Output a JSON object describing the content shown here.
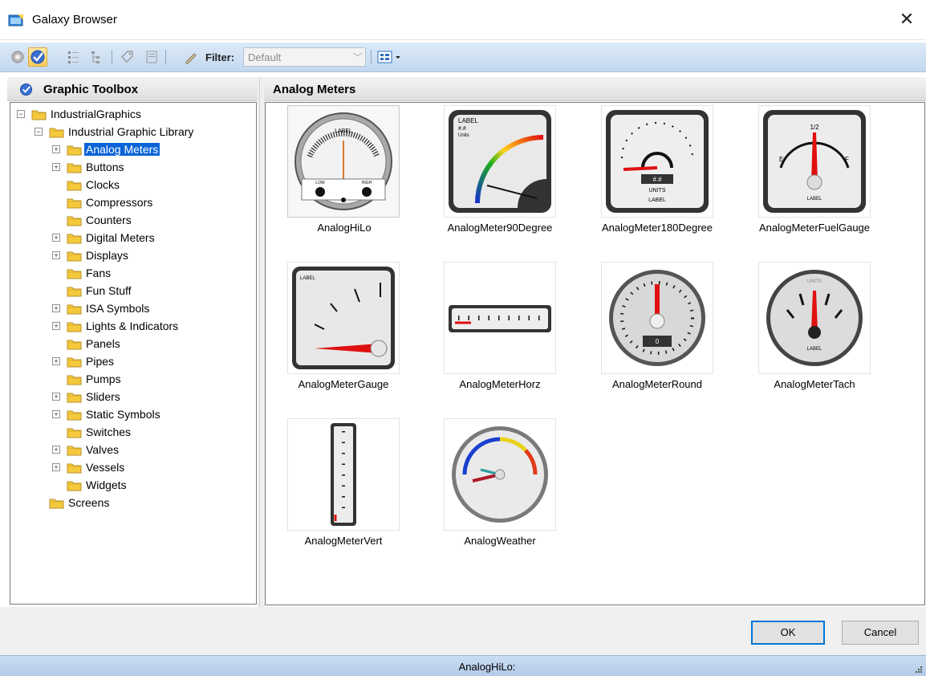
{
  "window": {
    "title": "Galaxy Browser",
    "close_glyph": "✕"
  },
  "toolbar": {
    "filter_label": "Filter:",
    "filter_value": "Default"
  },
  "left_panel": {
    "title": "Graphic Toolbox",
    "tree": [
      {
        "label": "IndustrialGraphics",
        "level": 0,
        "expander": "−"
      },
      {
        "label": "Industrial Graphic Library",
        "level": 1,
        "expander": "−"
      },
      {
        "label": "Analog Meters",
        "level": 2,
        "expander": "+",
        "selected": true
      },
      {
        "label": "Buttons",
        "level": 2,
        "expander": "+"
      },
      {
        "label": "Clocks",
        "level": 2,
        "expander": ""
      },
      {
        "label": "Compressors",
        "level": 2,
        "expander": ""
      },
      {
        "label": "Counters",
        "level": 2,
        "expander": ""
      },
      {
        "label": "Digital Meters",
        "level": 2,
        "expander": "+"
      },
      {
        "label": "Displays",
        "level": 2,
        "expander": "+"
      },
      {
        "label": "Fans",
        "level": 2,
        "expander": ""
      },
      {
        "label": "Fun Stuff",
        "level": 2,
        "expander": ""
      },
      {
        "label": "ISA Symbols",
        "level": 2,
        "expander": "+"
      },
      {
        "label": "Lights & Indicators",
        "level": 2,
        "expander": "+"
      },
      {
        "label": "Panels",
        "level": 2,
        "expander": ""
      },
      {
        "label": "Pipes",
        "level": 2,
        "expander": "+"
      },
      {
        "label": "Pumps",
        "level": 2,
        "expander": ""
      },
      {
        "label": "Sliders",
        "level": 2,
        "expander": "+"
      },
      {
        "label": "Static Symbols",
        "level": 2,
        "expander": "+"
      },
      {
        "label": "Switches",
        "level": 2,
        "expander": ""
      },
      {
        "label": "Valves",
        "level": 2,
        "expander": "+"
      },
      {
        "label": "Vessels",
        "level": 2,
        "expander": "+"
      },
      {
        "label": "Widgets",
        "level": 2,
        "expander": ""
      },
      {
        "label": "Screens",
        "level": 1,
        "expander": ""
      }
    ]
  },
  "right_panel": {
    "title": "Analog Meters",
    "items": [
      {
        "name": "AnalogHiLo",
        "selected": true,
        "icon": "analog-hilo-meter-icon",
        "texts": {
          "label": "LABEL",
          "low": "LOW",
          "high": "HIGH"
        }
      },
      {
        "name": "AnalogMeter90Degree",
        "icon": "analog-meter-90-degree-icon",
        "texts": {
          "label": "LABEL",
          "value": "#.#",
          "units": "Units"
        }
      },
      {
        "name": "AnalogMeter180Degree",
        "icon": "analog-meter-180-degree-icon",
        "texts": {
          "value": "#.#",
          "units": "UNITS",
          "label": "LABEL"
        }
      },
      {
        "name": "AnalogMeterFuelGauge",
        "icon": "fuel-gauge-icon",
        "texts": {
          "half": "1/2",
          "empty": "E",
          "full": "F",
          "label": "LABEL"
        }
      },
      {
        "name": "AnalogMeterGauge",
        "icon": "analog-meter-gauge-icon",
        "texts": {
          "label": "LABEL"
        }
      },
      {
        "name": "AnalogMeterHorz",
        "icon": "horizontal-meter-icon",
        "texts": {}
      },
      {
        "name": "AnalogMeterRound",
        "icon": "round-meter-icon",
        "texts": {
          "value": "0"
        }
      },
      {
        "name": "AnalogMeterTach",
        "icon": "tachometer-icon",
        "texts": {
          "units": "UNITS",
          "label": "LABEL"
        }
      },
      {
        "name": "AnalogMeterVert",
        "icon": "vertical-meter-icon",
        "texts": {}
      },
      {
        "name": "AnalogWeather",
        "icon": "weather-gauge-icon",
        "texts": {}
      }
    ]
  },
  "buttons": {
    "ok": "OK",
    "cancel": "Cancel"
  },
  "status": {
    "text": "AnalogHiLo:"
  },
  "colors": {
    "selection": "#0a64d8",
    "toolbar": "#c3d8ee",
    "needle_red": "#e01010",
    "folder_yellow": "#f5c93c"
  }
}
